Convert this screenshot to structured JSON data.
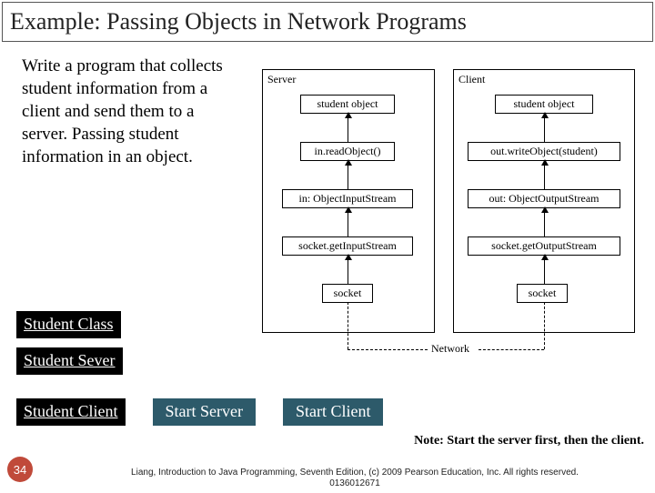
{
  "title": "Example: Passing Objects in Network Programs",
  "description": "Write a program that collects student information from a client and send them to a server. Passing student information in an object.",
  "buttons": {
    "student_class": "Student Class",
    "student_server": "Student Sever",
    "student_client": "Student Client",
    "start_server": "Start Server",
    "start_client": "Start Client"
  },
  "note": "Note: Start the server first, then the client.",
  "page_number": "34",
  "citation": "Liang, Introduction to Java Programming, Seventh Edition, (c) 2009 Pearson Education, Inc. All rights reserved. 0136012671",
  "diagram": {
    "server_header": "Server",
    "client_header": "Client",
    "server_boxes": [
      "student object",
      "in.readObject()",
      "in: ObjectInputStream",
      "socket.getInputStream",
      "socket"
    ],
    "client_boxes": [
      "student object",
      "out.writeObject(student)",
      "out: ObjectOutputStream",
      "socket.getOutputStream",
      "socket"
    ],
    "network_label": "Network"
  }
}
